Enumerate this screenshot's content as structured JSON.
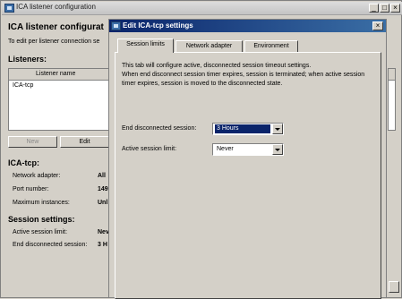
{
  "back_window": {
    "title": "ICA listener configuration",
    "heading": "ICA listener configurat",
    "description": "To edit per listener connection se",
    "listeners_label": "Listeners:",
    "list_column": "Listener name",
    "list_items": [
      "ICA-tcp"
    ],
    "buttons": {
      "new": "New",
      "edit": "Edit"
    },
    "details_heading": "ICA-tcp:",
    "details": [
      {
        "label": "Network adapter:",
        "value": "All"
      },
      {
        "label": "Port number:",
        "value": "149"
      },
      {
        "label": "Maximum instances:",
        "value": "Unl"
      }
    ],
    "session_heading": "Session settings:",
    "session": [
      {
        "label": "Active session limit:",
        "value": "Nev"
      },
      {
        "label": "End disconnected session:",
        "value": "3 H"
      }
    ]
  },
  "dialog": {
    "title": "Edit ICA-tcp settings",
    "tabs": [
      "Session limits",
      "Network adapter",
      "Environment"
    ],
    "active_tab": 0,
    "description_line1": "This tab will configure active, disconnected  session timeout settings.",
    "description_line2": "When end disconnect session timer expires, session is terminated; when active session timer expires, session is moved to the disconnected state.",
    "fields": {
      "end_disconnected": {
        "label": "End disconnected session:",
        "value": "3 Hours"
      },
      "active_limit": {
        "label": "Active session limit:",
        "value": "Never"
      }
    },
    "close_glyph": "×"
  },
  "window_controls": {
    "minimize": "_",
    "maximize": "□",
    "close": "×"
  }
}
